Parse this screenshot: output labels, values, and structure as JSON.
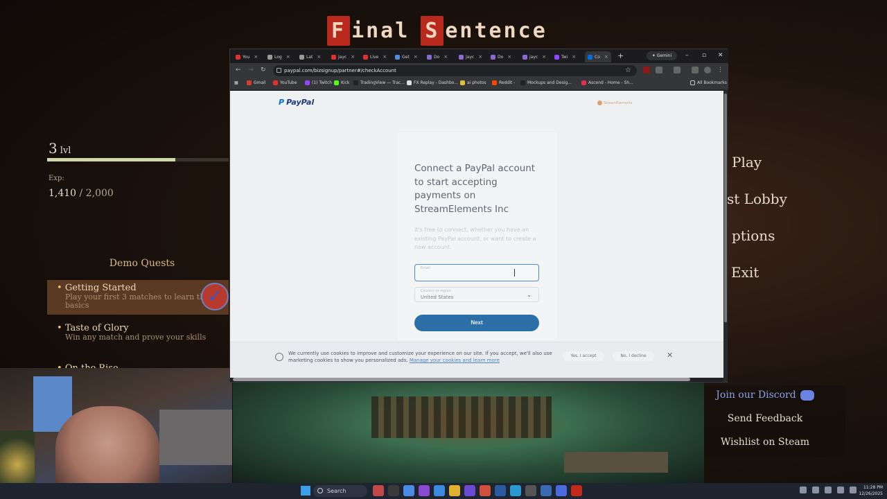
{
  "game": {
    "title_words": [
      {
        "cap": "F",
        "rest": "inal"
      },
      {
        "cap": "S",
        "rest": "entence"
      }
    ],
    "level": {
      "number": "3",
      "unit": "lvl"
    },
    "xp": {
      "label": "Exp:",
      "current": "1,410",
      "separator": " / ",
      "max": "2,000",
      "progress": 0.705
    },
    "quests": {
      "title": "Demo Quests",
      "items": [
        {
          "title": "Getting Started",
          "desc": "Play your first 3 matches to learn the basics"
        },
        {
          "title": "Taste of Glory",
          "desc": "Win any match and prove your skills"
        },
        {
          "title": "On the Rise",
          "desc": ""
        }
      ]
    },
    "menu": {
      "play": "Play",
      "lobby": "st Lobby",
      "options": "ptions",
      "exit": "Exit"
    },
    "links": {
      "discord": "Join our Discord",
      "feedback": "Send Feedback",
      "wishlist": "Wishlist on Steam"
    }
  },
  "browser": {
    "tabs": [
      {
        "label": "You",
        "color": "#e03030"
      },
      {
        "label": "Log",
        "color": "#9a9a9a"
      },
      {
        "label": "Lat",
        "color": "#9a9a9a"
      },
      {
        "label": "jayc",
        "color": "#e03030"
      },
      {
        "label": "Live",
        "color": "#e03030"
      },
      {
        "label": "Get",
        "color": "#4a90e2"
      },
      {
        "label": "Do",
        "color": "#8a6ad0"
      },
      {
        "label": "jayc",
        "color": "#8a6ad0"
      },
      {
        "label": "Do",
        "color": "#8a6ad0"
      },
      {
        "label": "jayc",
        "color": "#8a6ad0"
      },
      {
        "label": "Twi",
        "color": "#9146ff"
      },
      {
        "label": "Co",
        "color": "#0070e0"
      }
    ],
    "gemini_label": "Gemini",
    "url": "paypal.com/bizsignup/partner#/checkAccount",
    "bookmarks": [
      {
        "label": "Gmail",
        "color": "#d04030"
      },
      {
        "label": "YouTube",
        "color": "#e03030"
      },
      {
        "label": "(1) Twitch",
        "color": "#9146ff"
      },
      {
        "label": "Kick",
        "color": "#53fc18"
      },
      {
        "label": "TradingView — Trac...",
        "color": "#222222"
      },
      {
        "label": "FX Replay - Dashbo...",
        "color": "#dddddd"
      },
      {
        "label": "ai photos",
        "color": "#e0c030"
      },
      {
        "label": "Reddit -",
        "color": "#ff4500"
      },
      {
        "label": "Mockups and Desig...",
        "color": "#222222"
      },
      {
        "label": "Ascend - Home - Sh...",
        "color": "#e03050"
      }
    ],
    "all_bookmarks": "All Bookmarks"
  },
  "paypal": {
    "logo": "PayPal",
    "partner_logo": "StreamElements",
    "heading": "Connect a PayPal account to start accepting payments on StreamElements Inc",
    "subtext": "It's free to connect, whether you have an existing PayPal account, or want to create a new account.",
    "email_label": "Email",
    "email_value": "",
    "country_label": "Country or region",
    "country_value": "United States",
    "next_label": "Next",
    "cookie": {
      "text": "We currently use cookies to improve and customize your experience on our site. If you accept, we'll also use marketing cookies to show you personalized ads.",
      "link": "Manage your cookies and learn more",
      "accept": "Yes, I accept",
      "decline": "No, I decline"
    }
  },
  "taskbar": {
    "search": "Search",
    "time": "11:28 PM",
    "date": "12/26/2025"
  }
}
